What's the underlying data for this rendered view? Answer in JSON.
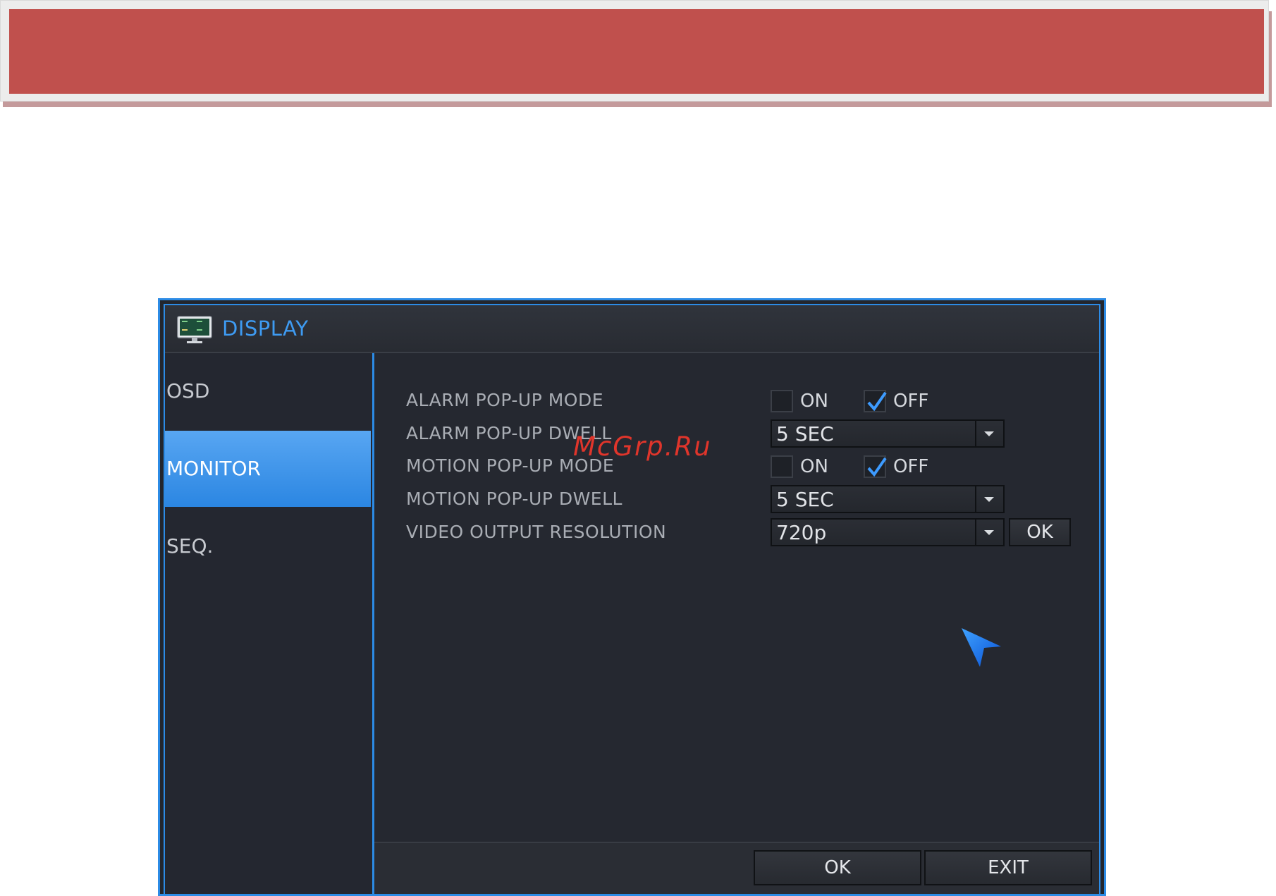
{
  "dialog": {
    "title": "DISPLAY",
    "icon": "monitor-icon",
    "accent_color": "#2c8be5"
  },
  "sidebar": {
    "items": [
      {
        "label": "OSD",
        "active": false
      },
      {
        "label": "MONITOR",
        "active": true
      },
      {
        "label": "SEQ.",
        "active": false
      }
    ]
  },
  "settings": {
    "alarm_popup_mode": {
      "label": "ALARM POP-UP MODE",
      "on_label": "ON",
      "off_label": "OFF",
      "on_checked": false,
      "off_checked": true
    },
    "alarm_popup_dwell": {
      "label": "ALARM POP-UP DWELL",
      "value": "5 SEC"
    },
    "motion_popup_mode": {
      "label": "MOTION POP-UP MODE",
      "on_label": "ON",
      "off_label": "OFF",
      "on_checked": false,
      "off_checked": true
    },
    "motion_popup_dwell": {
      "label": "MOTION POP-UP DWELL",
      "value": "5 SEC"
    },
    "video_output_resolution": {
      "label": "VIDEO OUTPUT RESOLUTION",
      "value": "720p",
      "apply_label": "OK"
    }
  },
  "footer": {
    "ok_label": "OK",
    "exit_label": "EXIT"
  },
  "watermark": "McGrp.Ru"
}
